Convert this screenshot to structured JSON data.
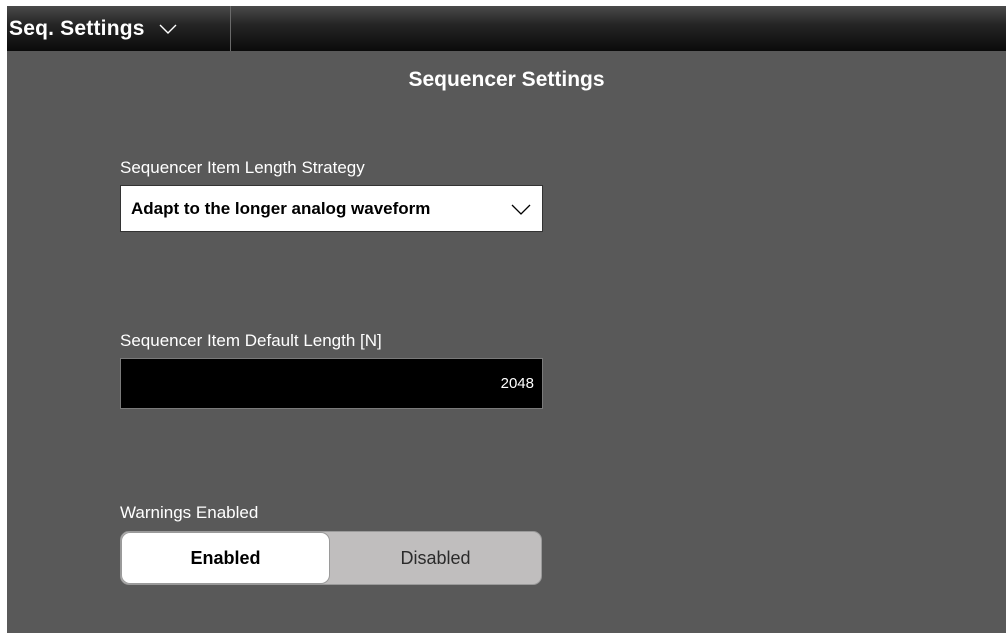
{
  "module": {
    "title": "Seq. Settings",
    "dropdown_icon": "chevron-down-icon"
  },
  "page": {
    "title": "Sequencer Settings"
  },
  "item_length_strategy": {
    "label": "Sequencer Item Length Strategy",
    "value": "Adapt to the longer analog waveform",
    "icon": "chevron-down-icon"
  },
  "default_length": {
    "label": "Sequencer Item Default Length [N]",
    "value": "2048"
  },
  "warnings": {
    "label": "Warnings Enabled",
    "options": [
      "Enabled",
      "Disabled"
    ],
    "selected": "Enabled"
  },
  "colors": {
    "panel_background": "#595959",
    "toggle_selected": "#ffffff",
    "toggle_unselected": "#c0bebe"
  }
}
